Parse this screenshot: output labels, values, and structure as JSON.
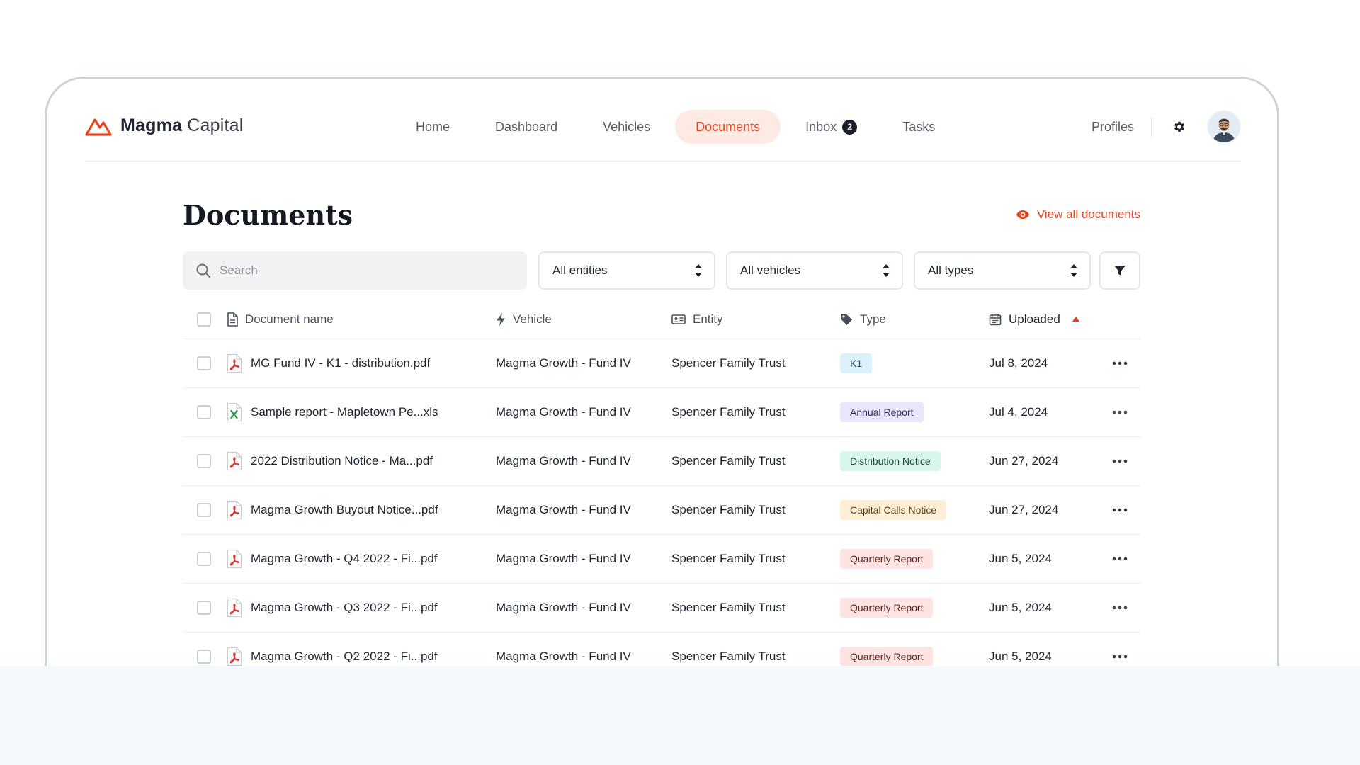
{
  "brand": {
    "name_bold": "Magma",
    "name_light": "Capital",
    "accent": "#e8431f"
  },
  "nav": {
    "items": [
      {
        "label": "Home"
      },
      {
        "label": "Dashboard"
      },
      {
        "label": "Vehicles"
      },
      {
        "label": "Documents",
        "active": true
      },
      {
        "label": "Inbox",
        "badge": "2"
      },
      {
        "label": "Tasks"
      }
    ],
    "profiles": "Profiles",
    "settings_icon": "gear-icon"
  },
  "page": {
    "title": "Documents",
    "view_all": "View all documents"
  },
  "filters": {
    "search_placeholder": "Search",
    "entities": "All entities",
    "vehicles": "All vehicles",
    "types": "All types"
  },
  "table": {
    "columns": {
      "name": "Document name",
      "vehicle": "Vehicle",
      "entity": "Entity",
      "type": "Type",
      "uploaded": "Uploaded"
    },
    "sort": {
      "column": "uploaded",
      "direction": "ascending"
    },
    "rows": [
      {
        "name": "MG Fund IV - K1 - distribution.pdf",
        "filetype": "pdf",
        "vehicle": "Magma Growth - Fund IV",
        "entity": "Spencer Family Trust",
        "type": "K1",
        "type_bg": "#dbf1fb",
        "type_fg": "#1f4a63",
        "uploaded": "Jul 8, 2024"
      },
      {
        "name": "Sample report - Mapletown Pe...xls",
        "filetype": "xls",
        "vehicle": "Magma Growth - Fund IV",
        "entity": "Spencer Family Trust",
        "type": "Annual Report",
        "type_bg": "#e8e6fb",
        "type_fg": "#2f2a5a",
        "uploaded": "Jul 4, 2024"
      },
      {
        "name": "2022 Distribution Notice - Ma...pdf",
        "filetype": "pdf",
        "vehicle": "Magma Growth - Fund IV",
        "entity": "Spencer Family Trust",
        "type": "Distribution Notice",
        "type_bg": "#d8f6ea",
        "type_fg": "#1f4a3a",
        "uploaded": "Jun 27, 2024"
      },
      {
        "name": "Magma Growth Buyout Notice...pdf",
        "filetype": "pdf",
        "vehicle": "Magma Growth - Fund IV",
        "entity": "Spencer Family Trust",
        "type": "Capital Calls Notice",
        "type_bg": "#fdeed6",
        "type_fg": "#5a3e14",
        "uploaded": "Jun 27, 2024"
      },
      {
        "name": "Magma Growth - Q4 2022 - Fi...pdf",
        "filetype": "pdf",
        "vehicle": "Magma Growth - Fund IV",
        "entity": "Spencer Family Trust",
        "type": "Quarterly Report",
        "type_bg": "#fde4e2",
        "type_fg": "#5a2420",
        "uploaded": "Jun 5, 2024"
      },
      {
        "name": "Magma Growth - Q3 2022 - Fi...pdf",
        "filetype": "pdf",
        "vehicle": "Magma Growth - Fund IV",
        "entity": "Spencer Family Trust",
        "type": "Quarterly Report",
        "type_bg": "#fde4e2",
        "type_fg": "#5a2420",
        "uploaded": "Jun 5, 2024"
      },
      {
        "name": "Magma Growth - Q2 2022 - Fi...pdf",
        "filetype": "pdf",
        "vehicle": "Magma Growth - Fund IV",
        "entity": "Spencer Family Trust",
        "type": "Quarterly Report",
        "type_bg": "#fde4e2",
        "type_fg": "#5a2420",
        "uploaded": "Jun 5, 2024"
      }
    ]
  }
}
